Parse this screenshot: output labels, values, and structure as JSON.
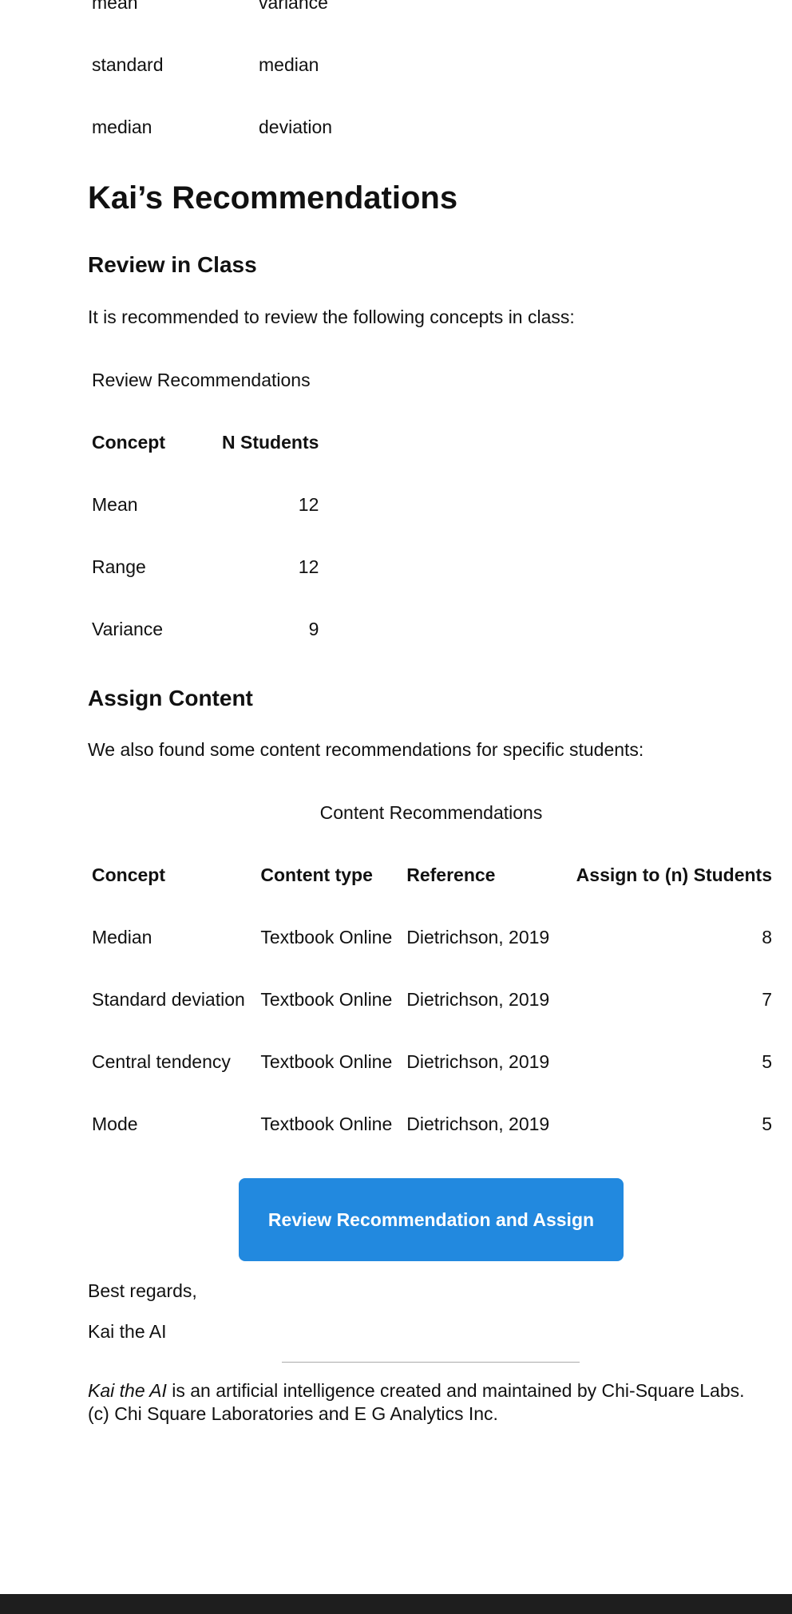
{
  "top_table": {
    "rows": [
      [
        "mean",
        "variance"
      ],
      [
        "standard",
        "median"
      ],
      [
        "median",
        "deviation"
      ]
    ]
  },
  "title": "Kai’s Recommendations",
  "review": {
    "heading": "Review in Class",
    "intro": "It is recommended to review the following concepts in class:",
    "caption": "Review Recommendations",
    "headers": [
      "Concept",
      "N Students"
    ],
    "rows": [
      [
        "Mean",
        "12"
      ],
      [
        "Range",
        "12"
      ],
      [
        "Variance",
        "9"
      ]
    ]
  },
  "assign": {
    "heading": "Assign Content",
    "intro": "We also found some content recommendations for specific students:",
    "caption": "Content Recommendations",
    "headers": [
      "Concept",
      "Content type",
      "Reference",
      "Assign to (n) Students"
    ],
    "rows": [
      [
        "Median",
        "Textbook Online",
        "Dietrichson, 2019",
        "8"
      ],
      [
        "Standard deviation",
        "Textbook Online",
        "Dietrichson, 2019",
        "7"
      ],
      [
        "Central tendency",
        "Textbook Online",
        "Dietrichson, 2019",
        "5"
      ],
      [
        "Mode",
        "Textbook Online",
        "Dietrichson, 2019",
        "5"
      ]
    ]
  },
  "button_label": "Review Recommendation and Assign",
  "closing": {
    "regards": "Best regards,",
    "signature": "Kai the AI"
  },
  "footer": {
    "emphasis": "Kai the AI",
    "text": " is an artificial intelligence created and maintained by Chi-Square Labs. (c) Chi Square Laboratories and E G Analytics Inc."
  },
  "colors": {
    "button": "#2289df",
    "bottom_bar": "#1e1e1e"
  }
}
